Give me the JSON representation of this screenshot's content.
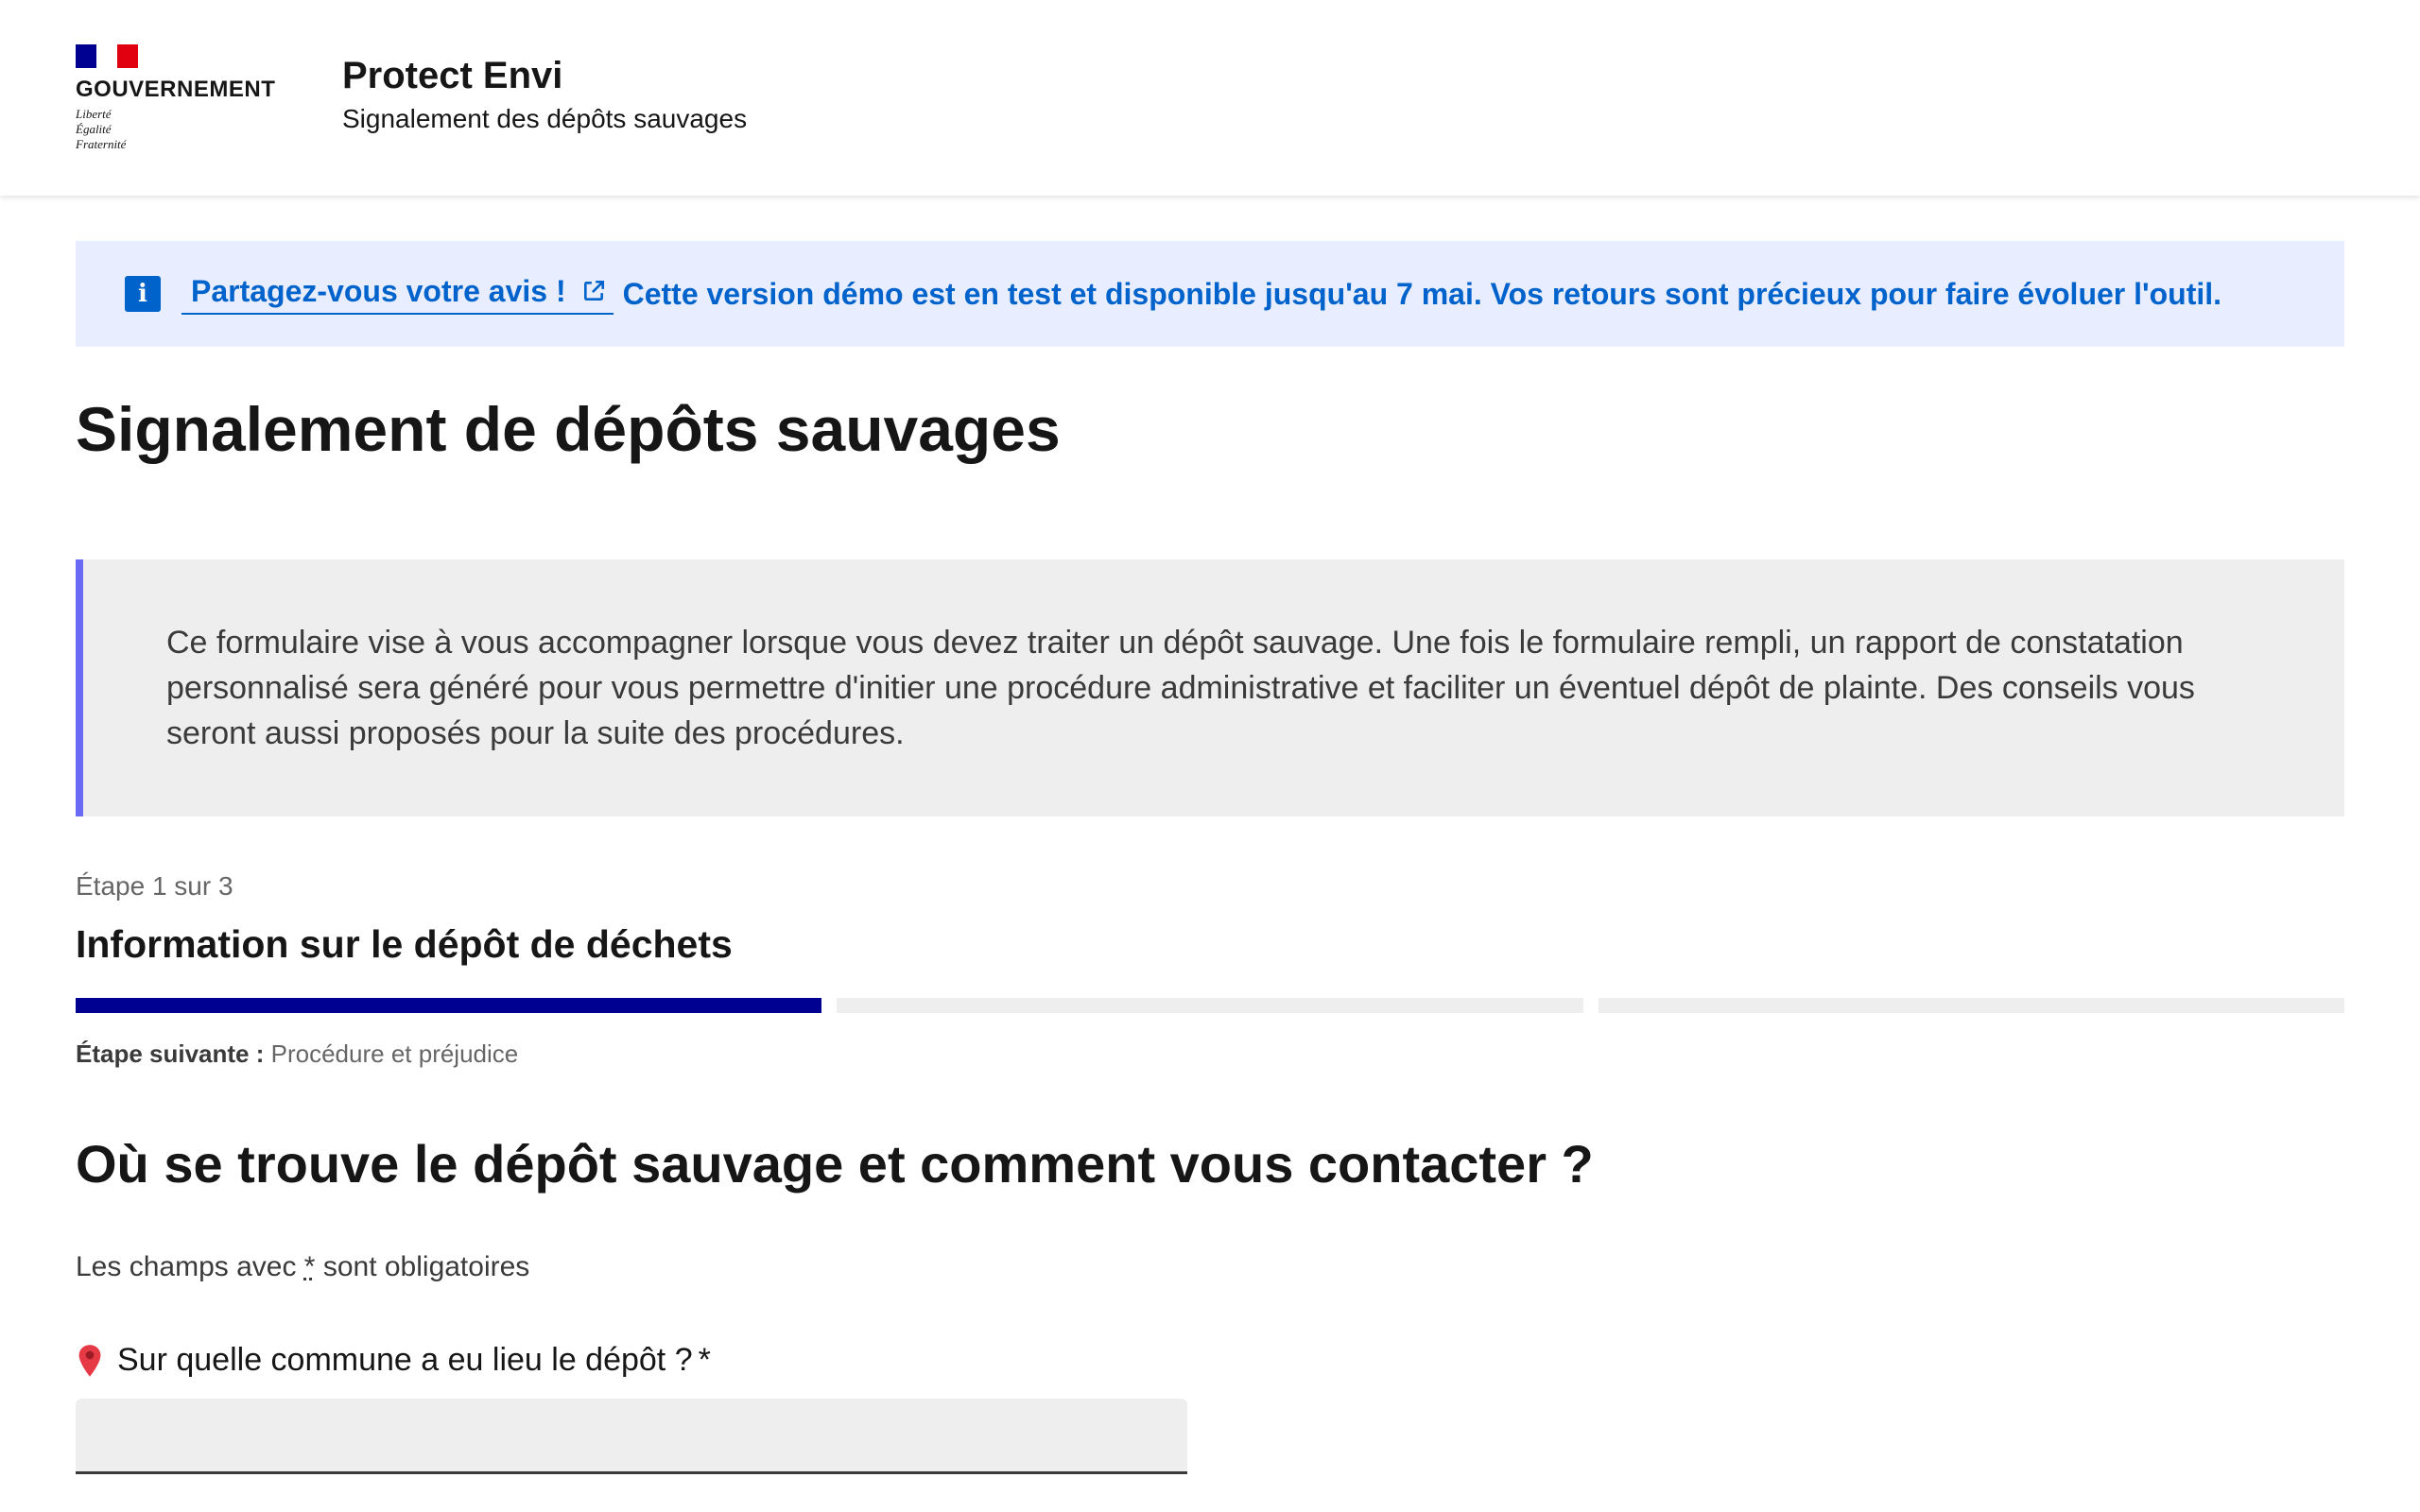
{
  "header": {
    "gov_name": "GOUVERNEMENT",
    "motto": [
      "Liberté",
      "Égalité",
      "Fraternité"
    ],
    "service_title": "Protect Envi",
    "service_tagline": "Signalement des dépôts sauvages"
  },
  "notice": {
    "link_text": "Partagez-vous votre avis !",
    "message": "Cette version démo est en test et disponible jusqu'au 7 mai. Vos retours sont précieux pour faire évoluer l'outil."
  },
  "page_title": "Signalement de dépôts sauvages",
  "callout": {
    "text": "Ce formulaire vise à vous accompagner lorsque vous devez traiter un dépôt sauvage. Une fois le formulaire rempli, un rapport de constatation personnalisé sera généré pour vous permettre d'initier une procédure administrative et faciliter un éventuel dépôt de plainte. Des conseils vous seront aussi proposés pour la suite des procédures."
  },
  "stepper": {
    "state": "Étape 1 sur 3",
    "title": "Information sur le dépôt de déchets",
    "next_label": "Étape suivante :",
    "next_value": "Procédure et préjudice",
    "current": 1,
    "total": 3
  },
  "section_title": "Où se trouve le dépôt sauvage et comment vous contacter ?",
  "required_hint": {
    "before": "Les champs avec",
    "star": "*",
    "after": "sont obligatoires"
  },
  "commune_field": {
    "label": "Sur quelle commune a eu lieu le dépôt ?",
    "required_mark": "*",
    "value": ""
  },
  "colors": {
    "primary": "#000091",
    "info": "#0063cb",
    "info_bg": "#e8edff",
    "callout_border": "#6a6af4",
    "grey_bg": "#eeeeee"
  }
}
